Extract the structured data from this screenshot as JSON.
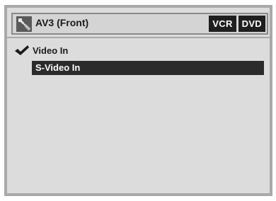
{
  "header": {
    "icon": "cable-connector-icon",
    "title": "AV3 (Front)",
    "modes": [
      "VCR",
      "DVD"
    ]
  },
  "menu": {
    "items": [
      {
        "label": "Video In",
        "checked": true,
        "selected": false
      },
      {
        "label": "S-Video In",
        "checked": false,
        "selected": true
      }
    ]
  },
  "colors": {
    "panel_bg": "#dcdcdc",
    "border": "#a9a9a9",
    "highlight": "#2b2b2b",
    "badge_bg": "#1f1f1f",
    "text": "#1a1a1a"
  }
}
